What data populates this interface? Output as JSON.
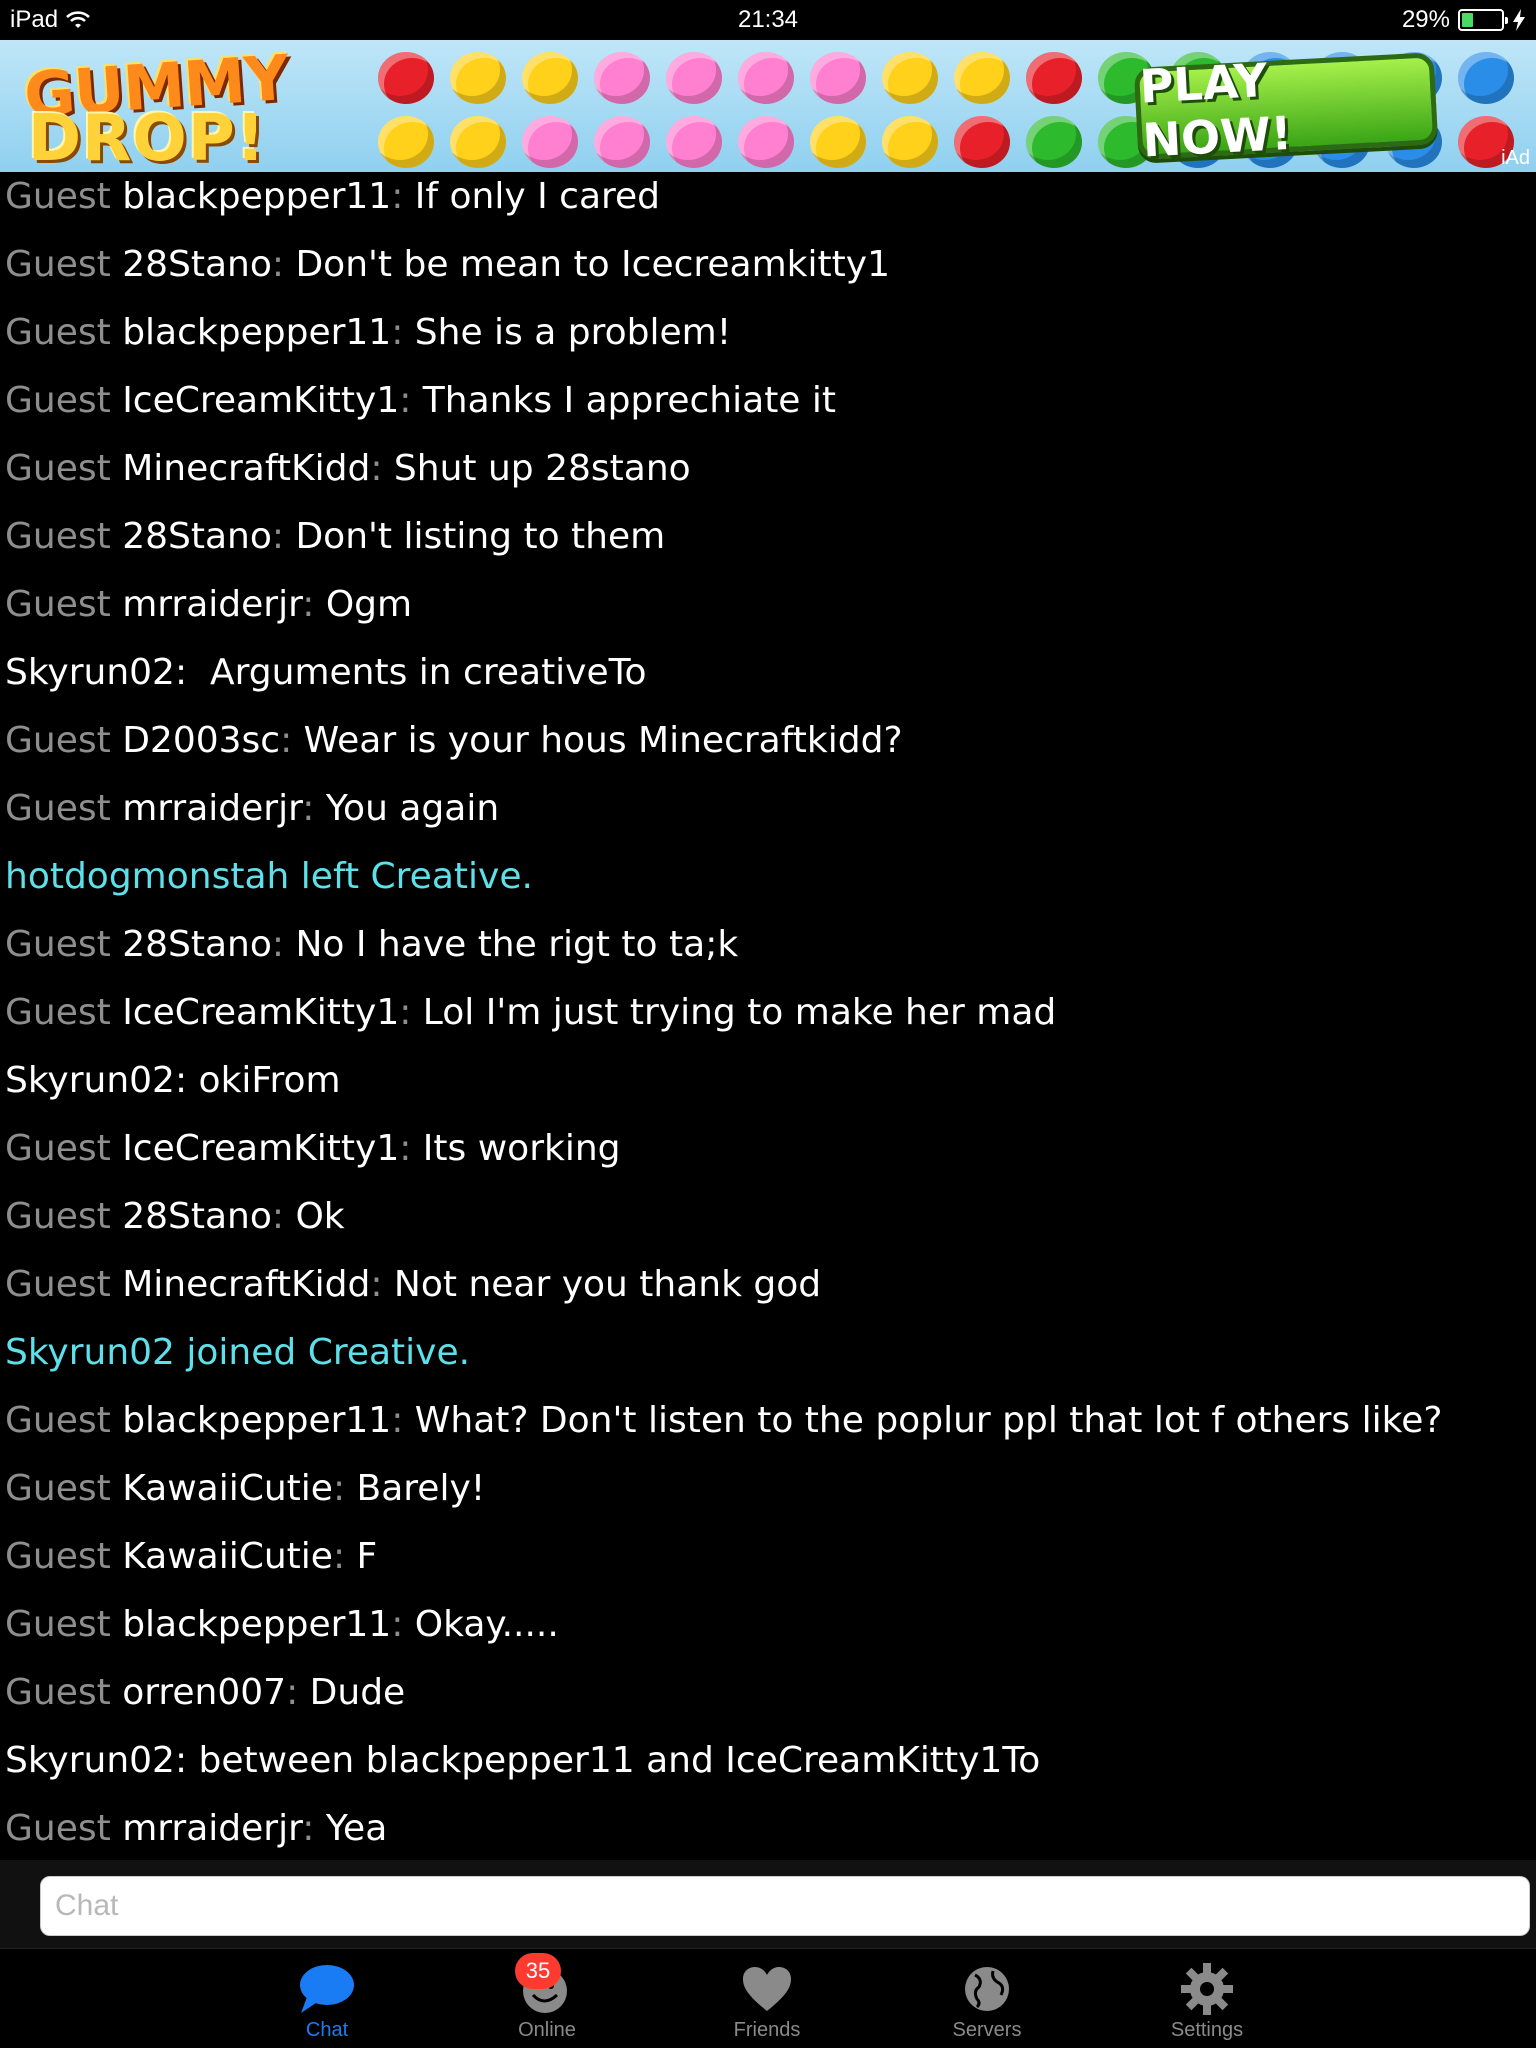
{
  "status_bar": {
    "device": "iPad",
    "time": "21:34",
    "battery_percent": "29%",
    "battery_level": 0.29
  },
  "ad": {
    "logo_line1": "GUMMY",
    "logo_line2": "DROP!",
    "cta": "PLAY NOW!",
    "badge": "iAd"
  },
  "chat": {
    "messages": [
      {
        "rank": "Guest",
        "user": "blackpepper11",
        "sep": ":",
        "text": " If only I cared"
      },
      {
        "rank": "Guest",
        "user": "28Stano",
        "sep": ":",
        "text": " Don't be mean to Icecreamkitty1"
      },
      {
        "rank": "Guest",
        "user": "blackpepper11",
        "sep": ":",
        "text": " She is a problem!"
      },
      {
        "rank": "Guest",
        "user": "IceCreamKitty1",
        "sep": ":",
        "text": " Thanks I apprechiate it"
      },
      {
        "rank": "Guest",
        "user": "MinecraftKidd",
        "sep": ":",
        "text": " Shut up 28stano"
      },
      {
        "rank": "Guest",
        "user": "28Stano",
        "sep": ":",
        "text": " Don't listing to them"
      },
      {
        "rank": "Guest",
        "user": "mrraiderjr",
        "sep": ":",
        "text": " Ogm"
      },
      {
        "rank": "",
        "user": "Skyrun02:",
        "sep": "",
        "text": "  Arguments in creativeTo"
      },
      {
        "rank": "Guest",
        "user": "D2003sc",
        "sep": ":",
        "text": " Wear is your hous Minecraftkidd?"
      },
      {
        "rank": "Guest",
        "user": "mrraiderjr",
        "sep": ":",
        "text": " You again"
      },
      {
        "event": true,
        "text": "hotdogmonstah left Creative."
      },
      {
        "rank": "Guest",
        "user": "28Stano",
        "sep": ":",
        "text": " No I have the rigt to ta;k"
      },
      {
        "rank": "Guest",
        "user": "IceCreamKitty1",
        "sep": ":",
        "text": " Lol I'm just trying to make her mad"
      },
      {
        "rank": "",
        "user": "Skyrun02:",
        "sep": "",
        "text": " okiFrom"
      },
      {
        "rank": "Guest",
        "user": "IceCreamKitty1",
        "sep": ":",
        "text": " Its working"
      },
      {
        "rank": "Guest",
        "user": "28Stano",
        "sep": ":",
        "text": " Ok"
      },
      {
        "rank": "Guest",
        "user": "MinecraftKidd",
        "sep": ":",
        "text": " Not near you thank god"
      },
      {
        "event": true,
        "text": "Skyrun02 joined Creative."
      },
      {
        "rank": "Guest",
        "user": "blackpepper11",
        "sep": ":",
        "text": " What? Don't listen to the poplur ppl that lot f others like?"
      },
      {
        "rank": "Guest",
        "user": "KawaiiCutie",
        "sep": ":",
        "text": " Barely!"
      },
      {
        "rank": "Guest",
        "user": "KawaiiCutie",
        "sep": ":",
        "text": " F"
      },
      {
        "rank": "Guest",
        "user": "blackpepper11",
        "sep": ":",
        "text": " Okay....."
      },
      {
        "rank": "Guest",
        "user": "orren007",
        "sep": ":",
        "text": " Dude"
      },
      {
        "rank": "",
        "user": "Skyrun02:",
        "sep": "",
        "text": " between blackpepper11 and IceCreamKitty1To"
      },
      {
        "rank": "Guest",
        "user": "mrraiderjr",
        "sep": ":",
        "text": " Yea"
      }
    ]
  },
  "input": {
    "placeholder": "Chat"
  },
  "tabs": [
    {
      "label": "Chat",
      "icon": "chat-bubble-icon",
      "active": true
    },
    {
      "label": "Online",
      "icon": "smiley-icon",
      "badge": "35"
    },
    {
      "label": "Friends",
      "icon": "heart-icon"
    },
    {
      "label": "Servers",
      "icon": "globe-icon"
    },
    {
      "label": "Settings",
      "icon": "gear-icon"
    }
  ],
  "colors": {
    "background": "#000000",
    "rank": "#8e8e8e",
    "event": "#5ee0ea",
    "tab_active": "#1a7cf5",
    "badge": "#ff3b30"
  }
}
